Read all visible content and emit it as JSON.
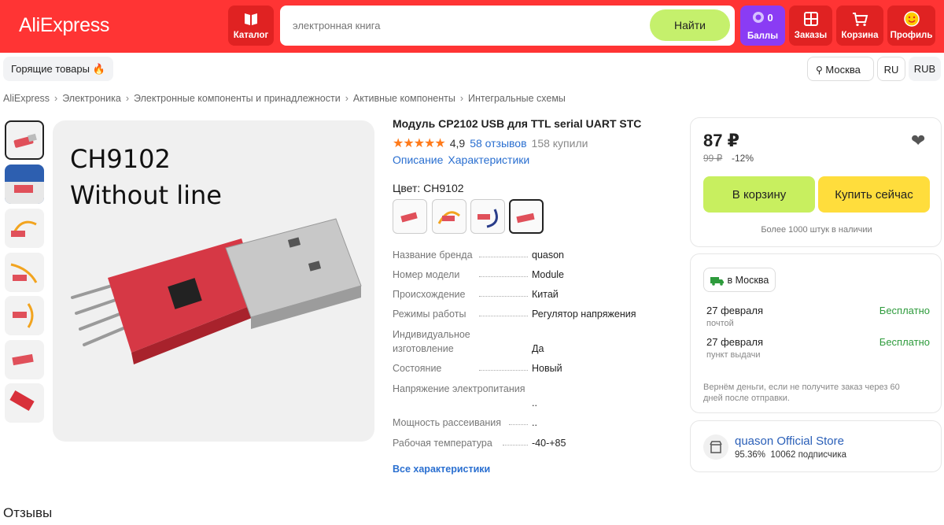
{
  "header": {
    "logo": "AliExpress",
    "catalog_label": "Каталог",
    "search_placeholder": "электронная книга",
    "search_button": "Найти",
    "points_count": "0",
    "points_label": "Баллы",
    "orders_label": "Заказы",
    "cart_label": "Корзина",
    "profile_label": "Профиль"
  },
  "subbar": {
    "hot_label": "Горящие товары",
    "city": "Москва",
    "lang": "RU",
    "currency": "RUB"
  },
  "breadcrumbs": [
    "AliExpress",
    "Электроника",
    "Электронные компоненты и принадлежности",
    "Активные компоненты",
    "Интегральные схемы"
  ],
  "gallery": {
    "main_text_line1": "CH9102",
    "main_text_line2": "Without line"
  },
  "product": {
    "title": "Модуль CP2102 USB для TTL serial UART STC",
    "stars": "★★★★★",
    "rating": "4,9",
    "reviews": "58 отзывов",
    "sold": "158 купили",
    "tab_description": "Описание",
    "tab_specs": "Характеристики",
    "color_label": "Цвет: CH9102",
    "all_specs_link": "Все характеристики",
    "specs": [
      {
        "k": "Название бренда",
        "v": "quason"
      },
      {
        "k": "Номер модели",
        "v": "Module"
      },
      {
        "k": "Происхождение",
        "v": "Китай"
      },
      {
        "k": "Режимы работы",
        "v": "Регулятор напряжения"
      },
      {
        "k": "Индивидуальное изготовление",
        "v": "Да"
      },
      {
        "k": "Состояние",
        "v": "Новый"
      },
      {
        "k": "Напряжение электропитания",
        "v": ".."
      },
      {
        "k": "Мощность рассеивания",
        "v": ".."
      },
      {
        "k": "Рабочая температура",
        "v": "-40-+85"
      }
    ]
  },
  "buy": {
    "price": "87 ₽",
    "old_price": "99 ₽",
    "discount": "-12%",
    "add_to_cart": "В корзину",
    "buy_now": "Купить сейчас",
    "stock": "Более 1000 штук в наличии"
  },
  "delivery": {
    "city_badge": "в Москва",
    "options": [
      {
        "date": "27 февраля",
        "method": "почтой",
        "price": "Бесплатно"
      },
      {
        "date": "27 февраля",
        "method": "пункт выдачи",
        "price": "Бесплатно"
      }
    ],
    "refund_note": "Вернём деньги, если не получите заказ через 60 дней после отправки."
  },
  "store": {
    "name": "quason Official Store",
    "positive": "95.36%",
    "followers": "10062 подписчика"
  },
  "reviews_section_title": "Отзывы",
  "colors": {
    "header_red": "#ff3434",
    "accent_green": "#c8ef5f",
    "accent_yellow": "#ffdd3c",
    "points_purple": "#8a3cf4",
    "link_blue": "#2a6fd0",
    "star_orange": "#ff7a1a"
  }
}
